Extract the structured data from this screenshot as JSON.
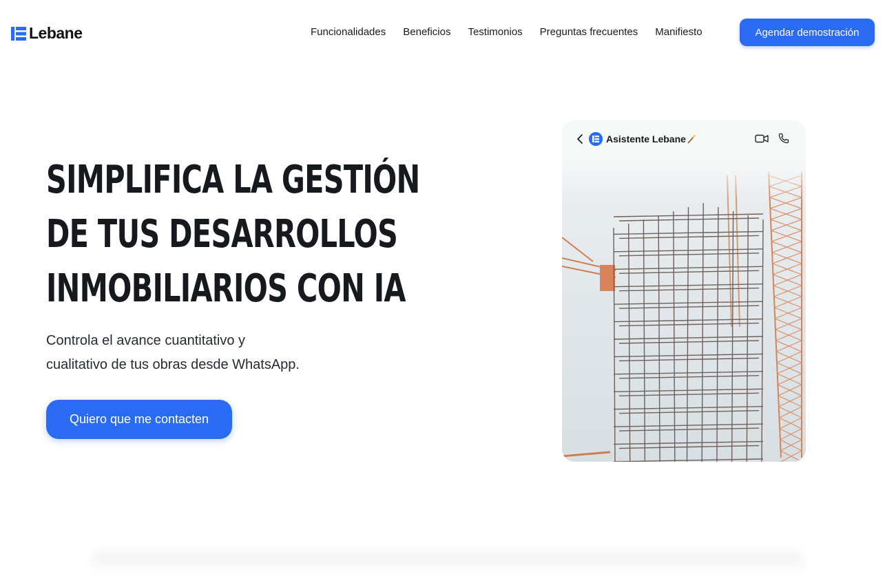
{
  "nav": {
    "logo_text": "Lebane",
    "links": [
      "Funcionalidades",
      "Beneficios",
      "Testimonios",
      "Preguntas frecuentes",
      "Manifiesto"
    ],
    "cta_label": "Agendar demostración"
  },
  "hero": {
    "title_lines": [
      "SIMPLIFICA LA GESTIÓN",
      "DE TUS DESARROLLOS",
      "INMOBILIARIOS CON IA"
    ],
    "subtitle_lines": [
      "Controla el avance cuantitativo y",
      "cualitativo de tus obras desde WhatsApp."
    ],
    "cta_label": "Quiero que me contacten"
  },
  "chat_card": {
    "assistant_name": "Asistente Lebane",
    "icons": [
      "back-arrow-icon",
      "lebane-avatar-icon",
      "magic-wand-icon",
      "video-call-icon",
      "phone-call-icon"
    ],
    "image": "building-under-construction-with-cranes"
  },
  "colors": {
    "brand_blue": "#2b6bf3",
    "text_dark": "#17191f",
    "crane_orange": "#d8845a",
    "steel": "#6e5f5a"
  }
}
